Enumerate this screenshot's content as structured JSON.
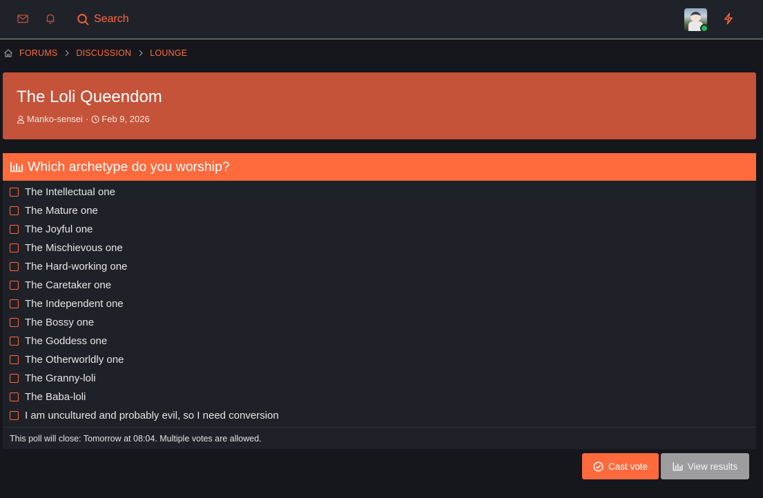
{
  "topbar": {
    "search_label": "Search",
    "icons": [
      "envelope-icon",
      "bell-icon",
      "search-icon",
      "lightning-icon"
    ],
    "accent_color": "#ff6a3d"
  },
  "breadcrumb": {
    "items": [
      "FORUMS",
      "DISCUSSION",
      "LOUNGE"
    ]
  },
  "thread": {
    "title": "The Loli Queendom",
    "author": "Manko-sensei",
    "separator": "·",
    "date": "Feb 9, 2026",
    "header_color": "#c4533a"
  },
  "poll": {
    "question": "Which archetype do you worship?",
    "options": [
      "The Intellectual one",
      "The Mature one",
      "The Joyful one",
      "The Mischievous one",
      "The Hard-working one",
      "The Caretaker one",
      "The Independent one",
      "The Bossy one",
      "The Goddess one",
      "The Otherworldly one",
      "The Granny-loli",
      "The Baba-loli",
      "I am uncultured and probably evil, so I need conversion"
    ],
    "footer": "This poll will close: Tomorrow at 08:04. Multiple votes are allowed."
  },
  "actions": {
    "cast_vote": "Cast vote",
    "view_results": "View results"
  }
}
